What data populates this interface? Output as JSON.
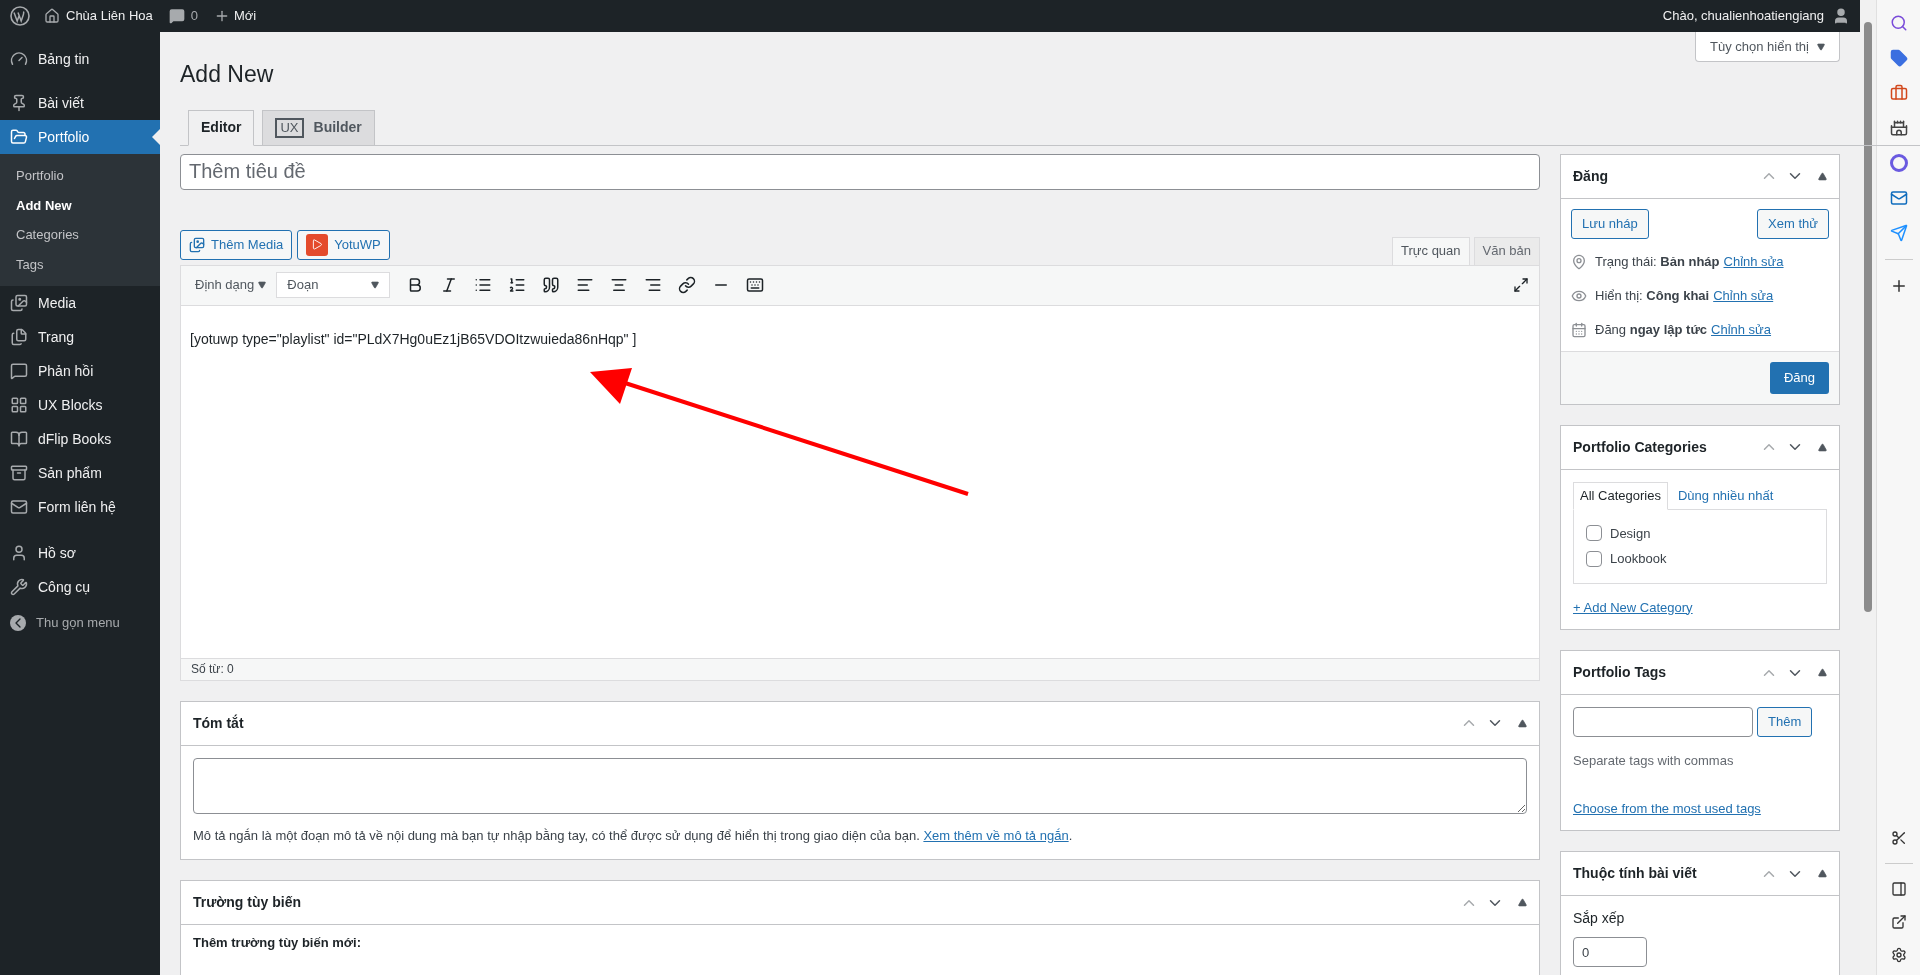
{
  "admin_bar": {
    "site_name": "Chùa Liên Hoa",
    "comments_count": "0",
    "new_label": "Mới",
    "greeting": "Chào, chualienhoatiengiang"
  },
  "sidebar": {
    "groups": [
      [
        {
          "label": "Bảng tin",
          "selected": false
        },
        {
          "label": "Bài viết",
          "selected": false
        },
        {
          "label": "Portfolio",
          "selected": true,
          "children": [
            {
              "label": "Portfolio",
              "selected": false
            },
            {
              "label": "Add New",
              "selected": true
            },
            {
              "label": "Categories",
              "selected": false
            },
            {
              "label": "Tags",
              "selected": false
            }
          ]
        },
        {
          "label": "Media",
          "selected": false
        },
        {
          "label": "Trang",
          "selected": false
        },
        {
          "label": "Phản hồi",
          "selected": false
        },
        {
          "label": "UX Blocks",
          "selected": false
        },
        {
          "label": "dFlip Books",
          "selected": false
        },
        {
          "label": "Sản phẩm",
          "selected": false
        },
        {
          "label": "Form liên hệ",
          "selected": false
        }
      ],
      [
        {
          "label": "Hồ sơ",
          "selected": false
        },
        {
          "label": "Công cụ",
          "selected": false
        }
      ]
    ],
    "collapse_label": "Thu gọn menu"
  },
  "page_title": "Add New",
  "screen_options": "Tùy chọn hiển thị",
  "tabs": [
    {
      "label": "Editor",
      "selected": true
    },
    {
      "label": "Builder",
      "badge": "UX",
      "selected": false
    }
  ],
  "title_field": {
    "placeholder": "Thêm tiêu đề"
  },
  "media_buttons": [
    {
      "label": "Thêm Media"
    },
    {
      "label": "YotuWP"
    }
  ],
  "editor": {
    "modes": [
      {
        "label": "Trực quan",
        "selected": true
      },
      {
        "label": "Văn bản",
        "selected": false
      }
    ],
    "format_menu": "Định dạng",
    "block_select": "Đoạn",
    "content": "[yotuwp type=\"playlist\" id=\"PLdX7Hg0uEz1jB65VDOItzwuieda86nHqp\" ]",
    "word_count": "Số từ: 0"
  },
  "excerpt": {
    "title": "Tóm tắt",
    "help": "Mô tả ngắn là một đoạn mô tả về nội dung mà bạn tự nhập bằng tay, có thể được sử dụng để hiển thị trong giao diện của bạn.",
    "link": "Xem thêm về mô tả ngắn",
    "end": "."
  },
  "custom_fields": {
    "title": "Trường tùy biến",
    "label": "Thêm trường tùy biến mới:"
  },
  "publish": {
    "title": "Đăng",
    "save_draft": "Lưu nháp",
    "preview": "Xem thử",
    "rows": [
      {
        "label": "Trạng thái:",
        "value": "Bản nháp",
        "link": "Chỉnh sửa"
      },
      {
        "label": "Hiển thị:",
        "value": "Công khai",
        "link": "Chỉnh sửa"
      },
      {
        "label": "Đăng",
        "value": "ngay lập tức",
        "link": "Chỉnh sửa"
      }
    ],
    "publish_button": "Đăng"
  },
  "categories": {
    "title": "Portfolio Categories",
    "tabs": [
      {
        "label": "All Categories",
        "selected": true
      },
      {
        "label": "Dùng nhiều nhất",
        "selected": false
      }
    ],
    "items": [
      {
        "label": "Design",
        "checked": false
      },
      {
        "label": "Lookbook",
        "checked": false
      }
    ],
    "add_link": "+ Add New Category"
  },
  "tags": {
    "title": "Portfolio Tags",
    "add_button": "Thêm",
    "hint": "Separate tags with commas",
    "link": "Choose from the most used tags"
  },
  "attributes": {
    "title": "Thuộc tính bài viết",
    "order_label": "Sắp xếp",
    "order_value": "0"
  }
}
